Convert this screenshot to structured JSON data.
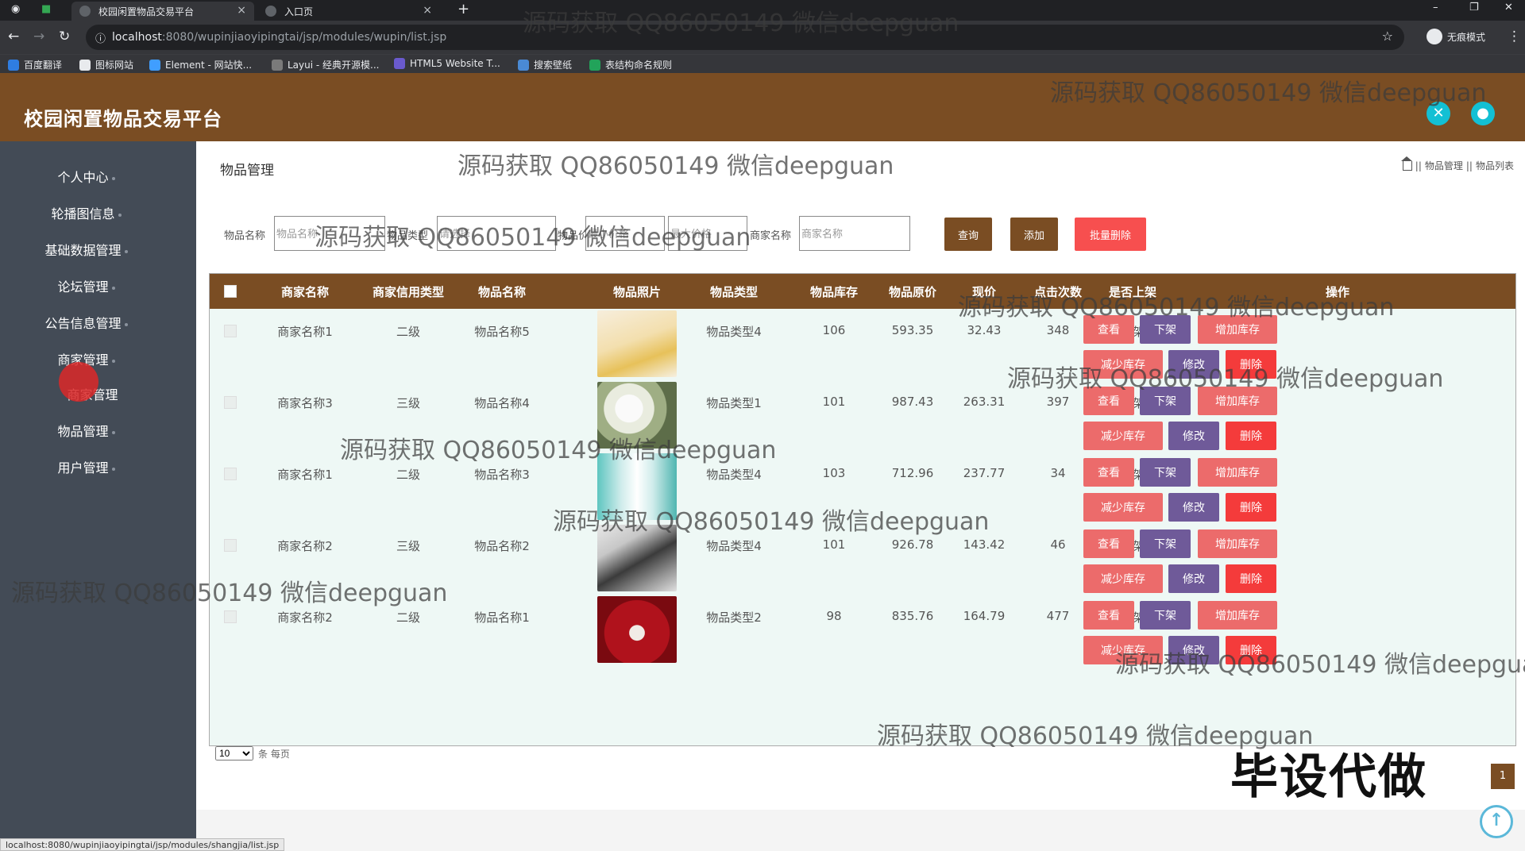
{
  "browser": {
    "tabs": [
      {
        "title": "校园闲置物品交易平台",
        "active": true
      },
      {
        "title": "入口页",
        "active": false
      }
    ],
    "url_host": "localhost",
    "url_path": ":8080/wupinjiaoyipingtai/jsp/modules/wupin/list.jsp",
    "incognito_label": "无痕模式",
    "bookmarks": [
      "百度翻译",
      "图标网站",
      "Element - 网站快...",
      "Layui - 经典开源模...",
      "HTML5 Website T...",
      "搜索壁纸",
      "表结构命名规则"
    ],
    "status_url": "localhost:8080/wupinjiaoyipingtai/jsp/modules/shangjia/list.jsp"
  },
  "app": {
    "title": "校园闲置物品交易平台",
    "accent": "#7a4d23"
  },
  "sidebar": {
    "items": [
      "个人中心",
      "轮播图信息",
      "基础数据管理",
      "论坛管理",
      "公告信息管理",
      "商家管理",
      "商家管理",
      "物品管理",
      "用户管理"
    ]
  },
  "page": {
    "title": "物品管理",
    "breadcrumb": [
      "物品管理",
      "物品列表"
    ],
    "separator": "||"
  },
  "search": {
    "labels": [
      "物品名称",
      "物品类型",
      "物品价格",
      "商家名称"
    ],
    "placeholders": [
      "物品名称",
      "请选择",
      "最小价格",
      "最大价格",
      "商家名称"
    ],
    "buttons": {
      "search": "查询",
      "add": "添加",
      "batch_delete": "批量删除"
    }
  },
  "table": {
    "headers": [
      "商家名称",
      "商家信用类型",
      "物品名称",
      "物品照片",
      "物品类型",
      "物品库存",
      "物品原价",
      "现价",
      "点击次数",
      "是否上架",
      "操作"
    ],
    "rows": [
      {
        "merchant": "商家名称1",
        "credit": "二级",
        "name": "物品名称5",
        "type": "物品类型4",
        "stock": "106",
        "orig_price": "593.35",
        "price": "32.43",
        "clicks": "348",
        "shelf": "上架",
        "photo": "gold"
      },
      {
        "merchant": "商家名称3",
        "credit": "三级",
        "name": "物品名称4",
        "type": "物品类型1",
        "stock": "101",
        "orig_price": "987.43",
        "price": "263.31",
        "clicks": "397",
        "shelf": "上架",
        "photo": "flowers"
      },
      {
        "merchant": "商家名称1",
        "credit": "二级",
        "name": "物品名称3",
        "type": "物品类型4",
        "stock": "103",
        "orig_price": "712.96",
        "price": "237.77",
        "clicks": "34",
        "shelf": "上架",
        "photo": "cosmetics"
      },
      {
        "merchant": "商家名称2",
        "credit": "三级",
        "name": "物品名称2",
        "type": "物品类型4",
        "stock": "101",
        "orig_price": "926.78",
        "price": "143.42",
        "clicks": "46",
        "shelf": "上架",
        "photo": "box"
      },
      {
        "merchant": "商家名称2",
        "credit": "二级",
        "name": "物品名称1",
        "type": "物品类型2",
        "stock": "98",
        "orig_price": "835.76",
        "price": "164.79",
        "clicks": "477",
        "shelf": "上架",
        "photo": "red"
      }
    ],
    "actions": {
      "view": "查看",
      "offshelf": "下架",
      "increase_stock": "增加库存",
      "decrease_stock": "减少库存",
      "edit": "修改",
      "delete": "删除"
    }
  },
  "pagination": {
    "page_size": "10",
    "suffix": "条 每页",
    "current_page": "1"
  },
  "overlay": {
    "watermark": "源码获取 QQ86050149 微信deepguan",
    "stamp": "毕设代做"
  }
}
